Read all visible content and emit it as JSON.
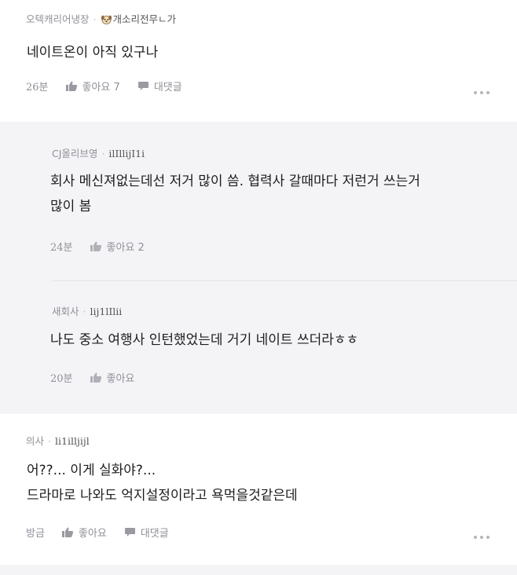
{
  "comments": [
    {
      "author": "오텍캐리어냉장",
      "nickname": "개소리전무ㄴ가",
      "lines": [
        "네이트온이 아직 있구나"
      ],
      "time": "26분",
      "like_label": "좋아요 7",
      "reply_label": "대댓글"
    },
    {
      "author": "CJ올리브영",
      "nickname": "ilIllijI1i",
      "lines": [
        "회사 메신져없는데선 저거 많이 씀. 협력사 갈때마다 저런거 쓰는거",
        "많이 봄"
      ],
      "time": "24분",
      "like_label": "좋아요 2"
    },
    {
      "author": "새회사",
      "nickname": "lij1lIlii",
      "lines": [
        "나도 중소 여행사 인턴했었는데 거기 네이트 쓰더라ㅎㅎ"
      ],
      "time": "20분",
      "like_label": "좋아요"
    },
    {
      "author": "의사",
      "nickname": "li1illjijl",
      "lines": [
        "어??... 이게 실화야?...",
        "드라마로 나와도 억지설정이라고 욕먹을것같은데"
      ],
      "time": "방금",
      "like_label": "좋아요",
      "reply_label": "대댓글"
    }
  ],
  "icons": {
    "like": "thumbs-up-icon",
    "reply": "speech-bubble-icon",
    "more": "more-dots-icon",
    "badge": "puppy-icon"
  },
  "colors": {
    "reply_background": "#f4f4f7",
    "meta_text": "#8f8f98"
  }
}
